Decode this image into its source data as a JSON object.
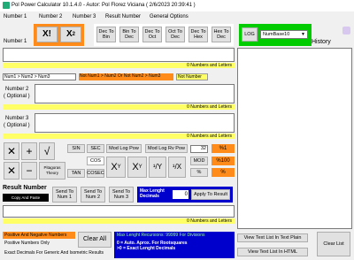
{
  "window": {
    "title": "Pol Power Calculator 10.1.4.0 -  Autor: Pol Florez Viciana  ( 2/6/2023 20:39:41 )"
  },
  "menu": [
    "Number 1",
    "Number 2",
    "Number 3",
    "Result Number",
    "General Options"
  ],
  "number1": {
    "label": "Number 1",
    "ops": {
      "inverse": "X!",
      "square": "X",
      "square_sup": "2"
    },
    "conversions": [
      "Dec To Bin",
      "Bin To Dec",
      "Dec To Oct",
      "Oct To Dec",
      "Dec To Hex",
      "Hex To Dec"
    ],
    "log_label": "LOG",
    "base_select": "NumBase10",
    "counter": "0 Numbers and Letters"
  },
  "history_label": "History",
  "comparisons": [
    "Num1 > Num2 > Num3",
    "Not Num1 > Num2 Or Not Num2 > Num3",
    "Not Number"
  ],
  "number2": {
    "label": "Number 2",
    "sub": "( Optional )",
    "counter": "0 Numbers and Letters"
  },
  "number3": {
    "label": "Number 3",
    "sub": "( Optional )",
    "counter": "0 Numbers and Letters"
  },
  "operations": {
    "sin": "SIN",
    "sec": "SEC",
    "cos": "COS",
    "cosec": "COSEC",
    "tan": "TAN",
    "cotan": "COTAN",
    "pythag": "Pitagoras Theory",
    "mod_log_pow": "Mod Log Pow",
    "mod_log_rv_pow": "Mod Log Rv Pow",
    "precision": "32",
    "pct1": "%1",
    "pct100": "%100",
    "mod": "MOD",
    "pct": "%",
    "mod_sub": "Module",
    "div_sub": "Divide"
  },
  "result": {
    "label": "Result Number",
    "copy_label": "Copy And Paste",
    "send_to": [
      "Send To Num 1",
      "Send To Num 2",
      "Send To Num 3"
    ],
    "max_length_label": "Max Lenght Decimals",
    "max_length_value": "0",
    "apply": "Apply To Result",
    "counter": "0 Numbers and Letters"
  },
  "footer": {
    "neg_pos": "Positive And Negative Numbers",
    "pos_only": "Positive Numbers Only",
    "exact": "Exact Decimals For Generic And Isometric Results",
    "clear_all": "Clear All",
    "max_length_info": "Max Lenght Recursions: 99999 For Divisions",
    "auto_info": "0 = Auto. Aprox. For Rootsquares\n>0 = Exact Lenght Decimals",
    "view_plain": "View Text List In Text Plain",
    "view_html": "View Text List In HTML",
    "clear_list": "Clear List"
  }
}
